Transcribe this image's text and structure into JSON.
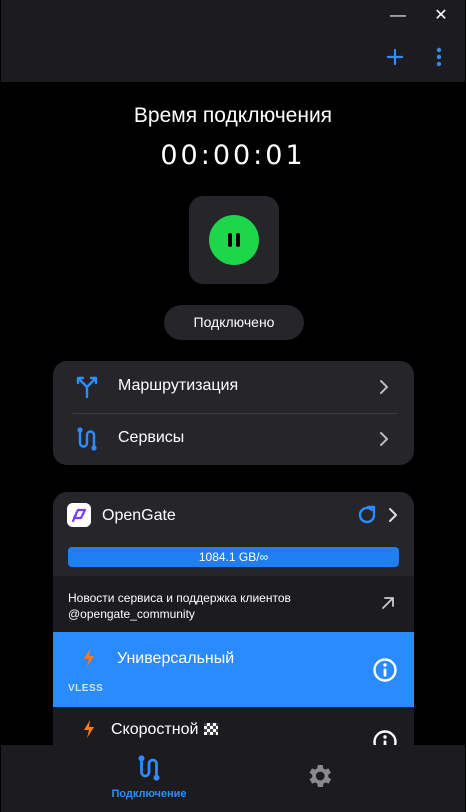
{
  "window": {
    "minimize_label": "—",
    "close_label": "✕"
  },
  "toolbar": {
    "add_icon": "plus-icon",
    "more_icon": "more-vertical-icon"
  },
  "connection": {
    "title": "Время подключения",
    "timer": "00:00:01",
    "status": "Подключено",
    "power_color": "#1ed64a"
  },
  "menu": {
    "items": [
      {
        "label": "Маршрутизация",
        "icon": "routing-icon"
      },
      {
        "label": "Сервисы",
        "icon": "services-icon"
      }
    ]
  },
  "server": {
    "name": "OpenGate",
    "traffic_text": "1084.1 GB/∞",
    "traffic_used_fraction": 0.0,
    "news_line1": "Новости сервиса и поддержка клиентов",
    "news_line2": "@opengate_community",
    "profiles": [
      {
        "name": "Универсальный",
        "protocol": "VLESS",
        "active": true
      },
      {
        "name": "Скоростной",
        "protocol": "",
        "active": false
      }
    ]
  },
  "nav": {
    "items": [
      {
        "label": "Подключение",
        "icon": "connection-icon",
        "active": true
      },
      {
        "label": "",
        "icon": "gear-icon",
        "active": false
      }
    ]
  },
  "colors": {
    "accent": "#2a8bff",
    "surface": "#262529",
    "background": "#000000",
    "connected": "#1ed64a"
  }
}
